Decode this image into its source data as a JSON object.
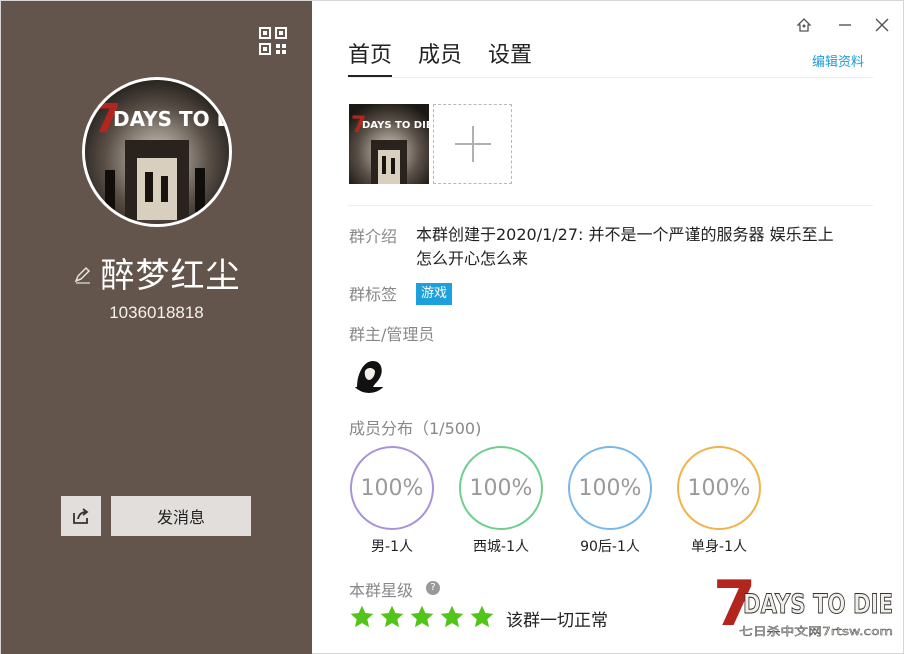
{
  "profile": {
    "name": "醉梦红尘",
    "id": "1036018818",
    "cover_text": "7DAYS TO DIE"
  },
  "left_actions": {
    "send_label": "发消息"
  },
  "tabs": [
    {
      "label": "首页",
      "active": true
    },
    {
      "label": "成员",
      "active": false
    },
    {
      "label": "设置",
      "active": false
    }
  ],
  "edit_profile_label": "编辑资料",
  "intro": {
    "label": "群介绍",
    "text": "本群创建于2020/1/27:  并不是一个严谨的服务器 娱乐至上 怎么开心怎么来"
  },
  "tags": {
    "label": "群标签",
    "items": [
      "游戏"
    ]
  },
  "admins": {
    "label": "群主/管理员"
  },
  "distribution": {
    "label": "成员分布（1/500)",
    "items": [
      {
        "value": "100%",
        "label": "男-1人",
        "color": "#a993d8"
      },
      {
        "value": "100%",
        "label": "西城-1人",
        "color": "#6fcf8e"
      },
      {
        "value": "100%",
        "label": "90后-1人",
        "color": "#7bb8ea"
      },
      {
        "value": "100%",
        "label": "单身-1人",
        "color": "#f0b44a"
      }
    ]
  },
  "rating": {
    "label": "本群星级",
    "stars": 5,
    "star_color": "#52c41a",
    "status": "该群一切正常"
  },
  "watermark": {
    "title": "7DAYS TO DIE",
    "subtitle": "七日杀中文网7rtsw.com"
  },
  "colors": {
    "sidebar": "#63554b",
    "accent": "#1e9bd7"
  }
}
